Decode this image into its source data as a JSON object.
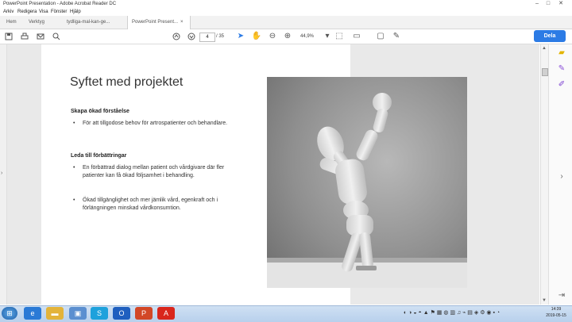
{
  "window": {
    "title": "PowerPoint Presentation - Adobe Acrobat Reader DC"
  },
  "menu": [
    "Arkiv",
    "Redigera",
    "Visa",
    "Fönster",
    "Hjälp"
  ],
  "tabs": {
    "home": "Hem",
    "tools": "Verktyg",
    "doc1": "tydliga-mal-kan-ge...",
    "doc2": "PowerPoint Present...",
    "close": "×"
  },
  "toolbar": {
    "page_current": "4",
    "page_total": "/ 35",
    "zoom": "44,9%",
    "share_label": "Dela"
  },
  "slide": {
    "title": "Syftet med projektet",
    "section1": {
      "heading": "Skapa ökad förståelse",
      "bullets": [
        "För att tillgodose behov för artrospatienter och behandlare."
      ]
    },
    "section2": {
      "heading": "Leda till förbättringar",
      "bullets": [
        "En förbättrad dialog mellan patient och vårdgivare där fler patienter kan få ökad följsamhet i behandling.",
        "Ökad tillgänglighet och mer jämlik vård, egenkraft och i förlängningen minskad vårdkonsumtion."
      ]
    }
  },
  "taskbar": {
    "clock_time": "14:39",
    "clock_date": "2019-05-15"
  },
  "colors": {
    "accent": "#2c7be5",
    "pdf_red": "#d9261c"
  }
}
